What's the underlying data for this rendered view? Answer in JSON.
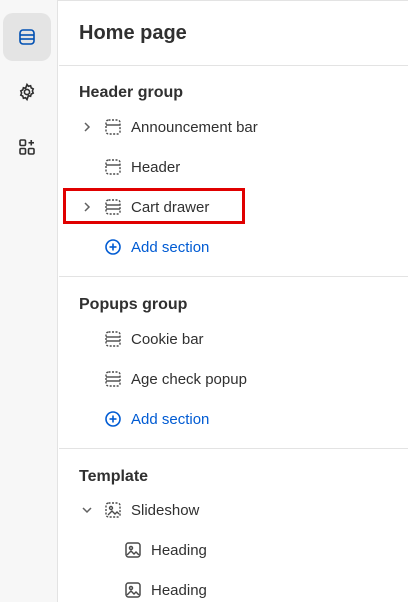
{
  "page": {
    "title": "Home page"
  },
  "rail": {
    "items": [
      {
        "name": "sections",
        "active": true
      },
      {
        "name": "settings",
        "active": false
      },
      {
        "name": "apps",
        "active": false
      }
    ]
  },
  "groups": [
    {
      "title": "Header group",
      "items": [
        {
          "label": "Announcement bar",
          "expandable": true
        },
        {
          "label": "Header",
          "expandable": false
        },
        {
          "label": "Cart drawer",
          "expandable": true,
          "highlighted": true
        }
      ],
      "add_label": "Add section"
    },
    {
      "title": "Popups group",
      "items": [
        {
          "label": "Cookie bar",
          "expandable": false
        },
        {
          "label": "Age check popup",
          "expandable": false
        }
      ],
      "add_label": "Add section"
    },
    {
      "title": "Template",
      "items": [
        {
          "label": "Slideshow",
          "expandable": true,
          "expanded": true
        },
        {
          "label": "Heading",
          "child": true
        },
        {
          "label": "Heading",
          "child": true
        }
      ]
    }
  ],
  "colors": {
    "accent": "#005bd3",
    "highlight": "#e00000"
  }
}
